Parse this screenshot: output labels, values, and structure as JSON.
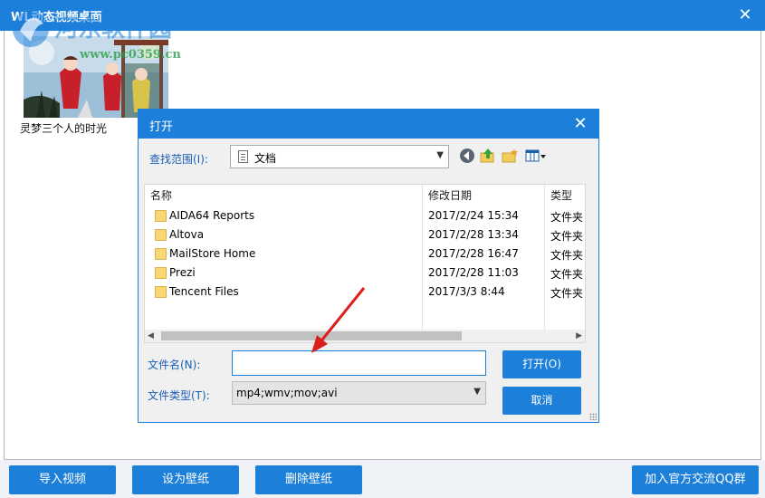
{
  "window": {
    "title": "WL动态视频桌面",
    "close_glyph": "✕"
  },
  "watermark": {
    "line1": "河东软件园",
    "line2": "www.pc0359.cn"
  },
  "videos": [
    {
      "caption": "灵梦三个人的时光"
    }
  ],
  "bottom_buttons": {
    "import": "导入视频",
    "set_wallpaper": "设为壁纸",
    "delete_wallpaper": "删除壁纸",
    "join_qq": "加入官方交流QQ群"
  },
  "dialog": {
    "title": "打开",
    "close_glyph": "✕",
    "look_in_label": "查找范围(I):",
    "look_in_value": "文档",
    "columns": {
      "name": "名称",
      "date": "修改日期",
      "type": "类型"
    },
    "files": [
      {
        "name": "AIDA64 Reports",
        "date": "2017/2/24 15:34",
        "type": "文件夹"
      },
      {
        "name": "Altova",
        "date": "2017/2/28 13:34",
        "type": "文件夹"
      },
      {
        "name": "MailStore Home",
        "date": "2017/2/28 16:47",
        "type": "文件夹"
      },
      {
        "name": "Prezi",
        "date": "2017/2/28 11:03",
        "type": "文件夹"
      },
      {
        "name": "Tencent Files",
        "date": "2017/3/3 8:44",
        "type": "文件夹"
      }
    ],
    "filename_label": "文件名(N):",
    "filename_value": "",
    "filetype_label": "文件类型(T):",
    "filetype_value": "mp4;wmv;mov;avi",
    "open_button": "打开(O)",
    "cancel_button": "取消"
  },
  "colors": {
    "accent": "#1c7fd9",
    "annotation_arrow": "#d9201a"
  }
}
